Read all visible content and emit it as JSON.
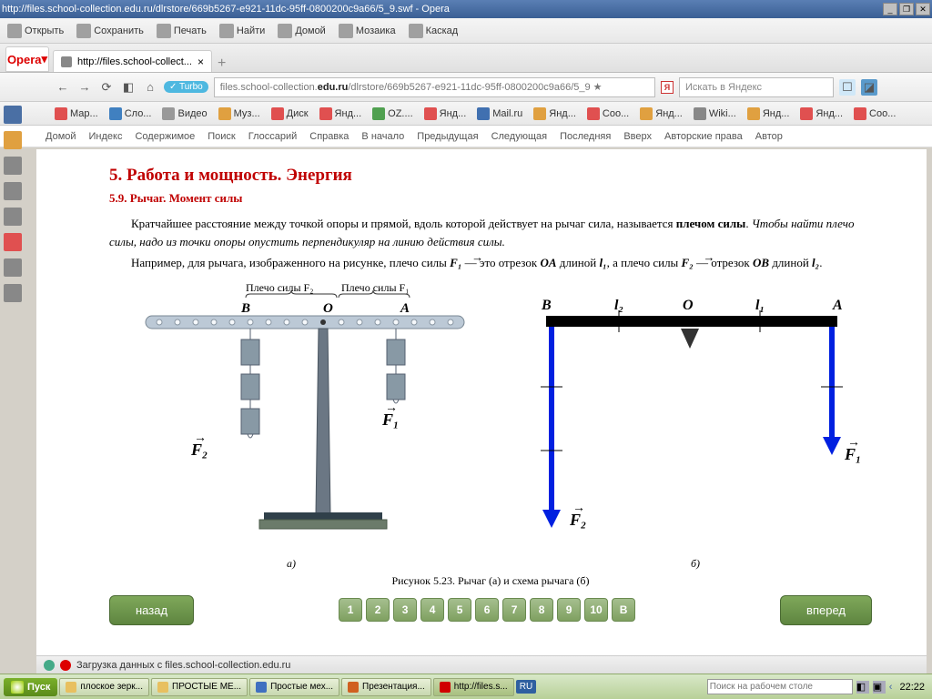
{
  "window": {
    "title": "http://files.school-collection.edu.ru/dlrstore/669b5267-e921-11dc-95ff-0800200c9a66/5_9.swf - Opera"
  },
  "toolbar": {
    "open": "Открыть",
    "save": "Сохранить",
    "print": "Печать",
    "find": "Найти",
    "home": "Домой",
    "mosaic": "Мозаика",
    "cascade": "Каскад"
  },
  "tabs": {
    "main": "Opera",
    "page": "http://files.school-collect..."
  },
  "nav": {
    "turbo": "Turbo",
    "url_domain": "files.school-collection.",
    "url_bold": "edu.ru",
    "url_rest": "/dlrstore/669b5267-e921-11dc-95ff-0800200c9a66/5_9 ★",
    "search_placeholder": "Искать в Яндекс"
  },
  "bookmarks": [
    "Мар...",
    "Сло...",
    "Видео",
    "Муз...",
    "Диск",
    "Янд...",
    "OZ....",
    "Янд...",
    "Mail.ru",
    "Янд...",
    "Соо...",
    "Янд...",
    "Wiki...",
    "Янд...",
    "Янд...",
    "Соо..."
  ],
  "bookmark_colors": [
    "#e05050",
    "#4080c0",
    "#999",
    "#e0a040",
    "#e05050",
    "#e05050",
    "#50a050",
    "#e05050",
    "#4070b0",
    "#e0a040",
    "#e05050",
    "#e0a040",
    "#888",
    "#e0a040",
    "#e05050",
    "#e05050"
  ],
  "textnav": [
    "Домой",
    "Индекс",
    "Содержимое",
    "Поиск",
    "Глоссарий",
    "Справка",
    "В начало",
    "Предыдущая",
    "Следующая",
    "Последняя",
    "Вверх",
    "Авторские права",
    "Автор"
  ],
  "content": {
    "h1": "5. Работа и мощность. Энергия",
    "h2": "5.9. Рычаг. Момент силы",
    "p1a": "Кратчайшее расстояние между точкой опоры и прямой, вдоль которой действует на рычаг сила, называется ",
    "p1b": "плечом силы",
    "p1c": ". ",
    "p1d": "Чтобы найти плечо силы, надо из точки опоры опустить перпендикуляр на линию действия силы.",
    "p2a": "Например, для рычага, изображенного на рисунке, плечо силы ",
    "p2b": " — это отрезок ",
    "p2c": " длиной ",
    "p2d": ", а плечо силы ",
    "p2e": " — отрезок ",
    "p2f": " длиной ",
    "lbl_plecho_F2": "Плечо силы F₂",
    "lbl_plecho_F1": "Плечо силы F₁",
    "ptB": "B",
    "ptO": "O",
    "ptA": "A",
    "F1": "F₁",
    "F2": "F₂",
    "l1": "l₁",
    "l2": "l₂",
    "OA": "OA",
    "OB": "OB",
    "cap_a": "а)",
    "cap_b": "б)",
    "figcap": "Рисунок 5.23. Рычаг (а) и схема рычага (б)",
    "back": "назад",
    "forward": "вперед",
    "nums": [
      "1",
      "2",
      "3",
      "4",
      "5",
      "6",
      "7",
      "8",
      "9",
      "10",
      "B"
    ]
  },
  "status": {
    "text": "Загрузка данных с files.school-collection.edu.ru"
  },
  "taskbar": {
    "start": "Пуск",
    "items": [
      "плоское зерк...",
      "ПРОСТЫЕ МЕ...",
      "Простые мех...",
      "Презентация...",
      "http://files.s..."
    ],
    "lang": "RU",
    "search": "Поиск на рабочем столе",
    "time": "22:22"
  }
}
